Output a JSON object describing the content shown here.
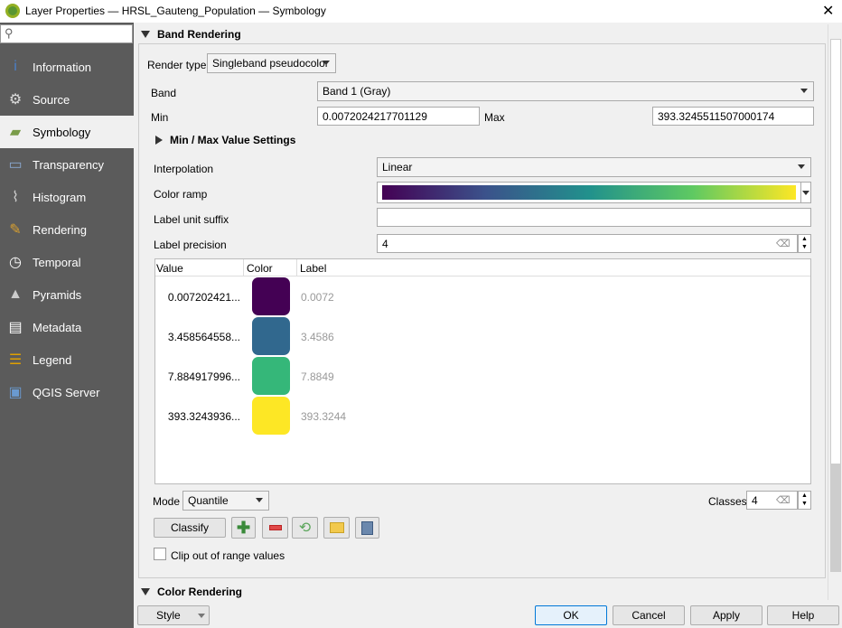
{
  "window": {
    "title": "Layer Properties — HRSL_Gauteng_Population — Symbology"
  },
  "sidebar": {
    "search_placeholder": "",
    "items": [
      {
        "label": "Information",
        "icon": "info-icon"
      },
      {
        "label": "Source",
        "icon": "source-icon"
      },
      {
        "label": "Symbology",
        "icon": "symbology-icon",
        "selected": true
      },
      {
        "label": "Transparency",
        "icon": "transparency-icon"
      },
      {
        "label": "Histogram",
        "icon": "histogram-icon"
      },
      {
        "label": "Rendering",
        "icon": "rendering-icon"
      },
      {
        "label": "Temporal",
        "icon": "clock-icon"
      },
      {
        "label": "Pyramids",
        "icon": "pyramids-icon"
      },
      {
        "label": "Metadata",
        "icon": "metadata-icon"
      },
      {
        "label": "Legend",
        "icon": "legend-icon"
      },
      {
        "label": "QGIS Server",
        "icon": "server-icon"
      }
    ]
  },
  "band_rendering": {
    "title": "Band Rendering",
    "render_type_label": "Render type",
    "render_type": "Singleband pseudocolor",
    "band_label": "Band",
    "band": "Band 1 (Gray)",
    "min_label": "Min",
    "min": "0.0072024217701129",
    "max_label": "Max",
    "max": "393.3245511507000174",
    "minmax_settings": "Min / Max Value Settings",
    "interpolation_label": "Interpolation",
    "interpolation": "Linear",
    "color_ramp_label": "Color ramp",
    "color_ramp": [
      "#440154",
      "#3b528b",
      "#21918c",
      "#5ec962",
      "#fde725"
    ],
    "label_suffix_label": "Label unit suffix",
    "label_suffix": "",
    "label_precision_label": "Label precision",
    "label_precision": "4",
    "table": {
      "headers": [
        "Value",
        "Color",
        "Label"
      ],
      "rows": [
        {
          "value": "0.007202421...",
          "color": "#440154",
          "label": "0.0072"
        },
        {
          "value": "3.458564558...",
          "color": "#31688e",
          "label": "3.4586"
        },
        {
          "value": "7.884917996...",
          "color": "#35b779",
          "label": "7.8849"
        },
        {
          "value": "393.3243936...",
          "color": "#fde725",
          "label": "393.3244"
        }
      ]
    },
    "mode_label": "Mode",
    "mode": "Quantile",
    "classes_label": "Classes",
    "classes": "4",
    "classify": "Classify",
    "clip_label": "Clip out of range values",
    "clip_checked": false
  },
  "color_rendering": {
    "title": "Color Rendering"
  },
  "footer": {
    "style": "Style",
    "ok": "OK",
    "cancel": "Cancel",
    "apply": "Apply",
    "help": "Help"
  }
}
